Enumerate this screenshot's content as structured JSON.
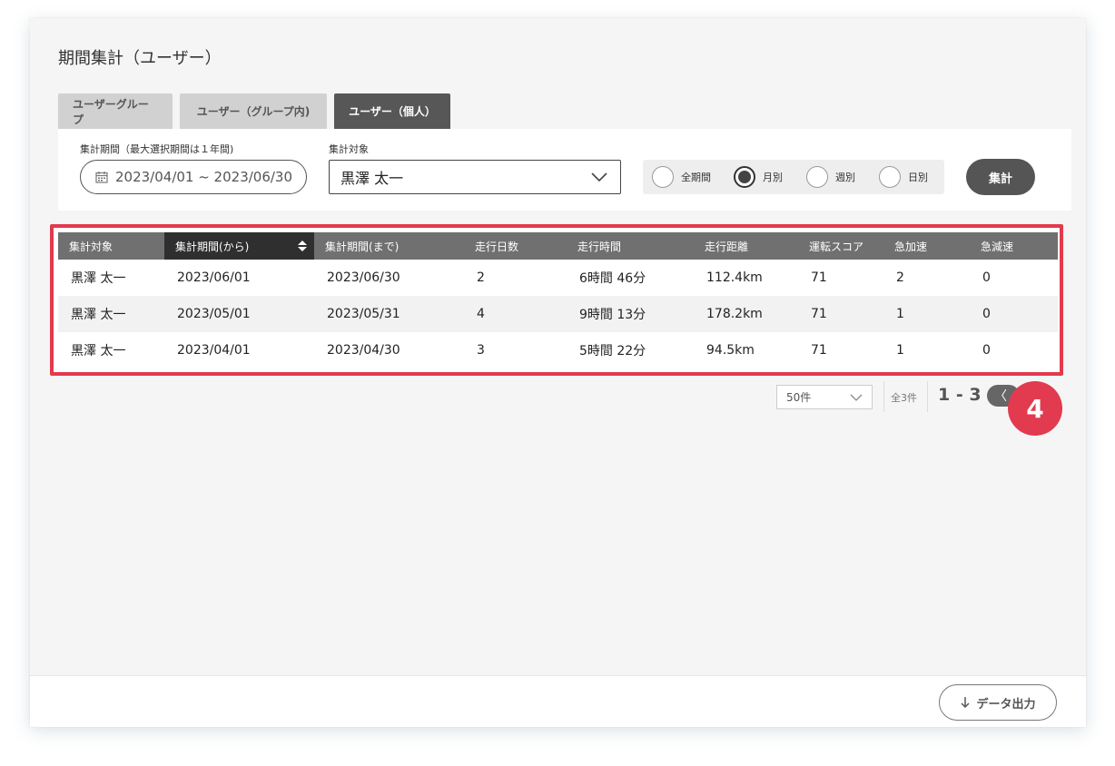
{
  "page_title": "期間集計（ユーザー）",
  "tabs": [
    {
      "label": "ユーザーグループ",
      "active": false
    },
    {
      "label": "ユーザー（グループ内)",
      "active": false
    },
    {
      "label": "ユーザー（個人）",
      "active": true
    }
  ],
  "filters": {
    "period_label": "集計期間（最大選択期間は１年間)",
    "period_value": "2023/04/01 ~ 2023/06/30",
    "target_label": "集計対象",
    "target_value": "黒澤 太一",
    "granularity": {
      "options": [
        "全期間",
        "月別",
        "週別",
        "日別"
      ],
      "selected": "月別"
    },
    "submit_label": "集計"
  },
  "table": {
    "columns": [
      "集計対象",
      "集計期間(から)",
      "集計期間(まで)",
      "走行日数",
      "走行時間",
      "走行距離",
      "運転スコア",
      "急加速",
      "急減速"
    ],
    "sorted_column": "集計期間(から)",
    "rows": [
      [
        "黒澤 太一",
        "2023/06/01",
        "2023/06/30",
        "2",
        "6時間 46分",
        "112.4km",
        "71",
        "2",
        "0"
      ],
      [
        "黒澤 太一",
        "2023/05/01",
        "2023/05/31",
        "4",
        "9時間 13分",
        "178.2km",
        "71",
        "1",
        "0"
      ],
      [
        "黒澤 太一",
        "2023/04/01",
        "2023/04/30",
        "3",
        "5時間 22分",
        "94.5km",
        "71",
        "1",
        "0"
      ]
    ]
  },
  "pagination": {
    "page_size": "50件",
    "total": "全3件",
    "range": "1 - 3",
    "prev_symbol": "〈"
  },
  "step_badge": "4",
  "footer": {
    "export_label": "データ出力"
  },
  "colors": {
    "accent_red": "#e23a4e",
    "header_gray": "#707070",
    "active_tab": "#575757"
  }
}
